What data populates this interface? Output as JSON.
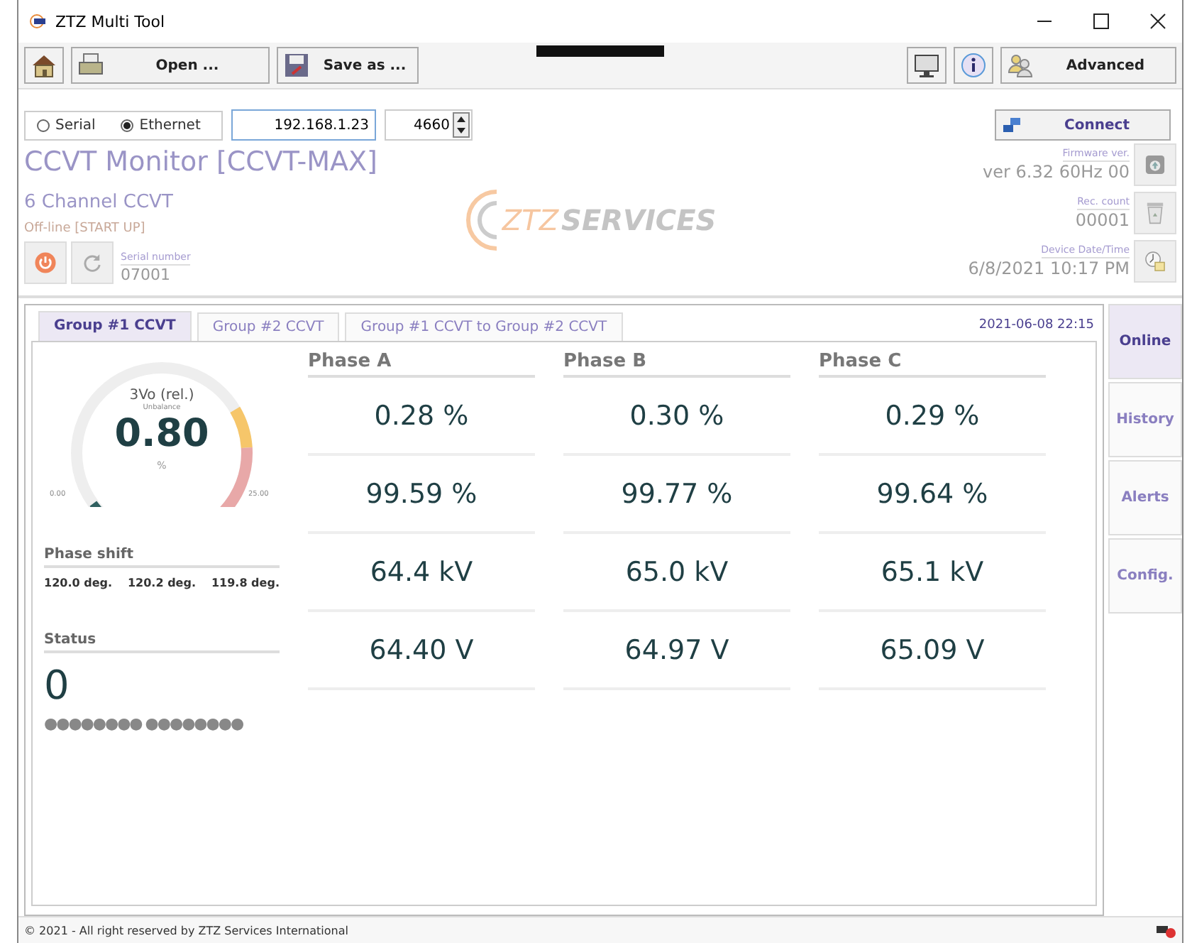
{
  "window": {
    "title": "ZTZ Multi Tool"
  },
  "toolbar": {
    "open": "Open ...",
    "save": "Save as ...",
    "advanced": "Advanced"
  },
  "connection": {
    "options": [
      {
        "label": "Serial",
        "selected": false
      },
      {
        "label": "Ethernet",
        "selected": true
      }
    ],
    "address": "192.168.1.23",
    "port": "4660",
    "connect": "Connect"
  },
  "device": {
    "title": "CCVT Monitor [CCVT-MAX]",
    "subtitle": "6 Channel CCVT",
    "state": "Off-line [START UP]",
    "serial_label": "Serial number",
    "serial": "07001"
  },
  "logo": {
    "brand": "ZTZ",
    "word": "SERVICES"
  },
  "info": [
    {
      "label": "Firmware ver.",
      "value": "ver 6.32  60Hz 00",
      "kind": "chip"
    },
    {
      "label": "Rec. count",
      "value": "00001",
      "kind": "bin"
    },
    {
      "label": "Device Date/Time",
      "value": "6/8/2021 10:17 PM",
      "kind": "clock"
    }
  ],
  "group_tabs": [
    {
      "label": "Group #1 CCVT",
      "selected": true
    },
    {
      "label": "Group #2 CCVT",
      "selected": false
    },
    {
      "label": "Group #1 CCVT to Group #2 CCVT",
      "selected": false
    }
  ],
  "timestamp": "2021-06-08 22:15",
  "gauge": {
    "title": "3Vo (rel.)",
    "subtitle": "Unbalance",
    "value": "0.80",
    "unit": "%",
    "min": "0.00",
    "max": "25.00"
  },
  "phase_shift": {
    "label": "Phase shift",
    "values": [
      "120.0 deg.",
      "120.2 deg.",
      "119.8 deg."
    ]
  },
  "status": {
    "label": "Status",
    "value": "0",
    "bits": "●●●●●●●● ●●●●●●●●"
  },
  "phases": [
    {
      "name": "Phase A",
      "values": [
        "0.28 %",
        "99.59 %",
        "64.4 kV",
        "64.40 V"
      ]
    },
    {
      "name": "Phase B",
      "values": [
        "0.30 %",
        "99.77 %",
        "65.0 kV",
        "64.97 V"
      ]
    },
    {
      "name": "Phase C",
      "values": [
        "0.29 %",
        "99.64 %",
        "65.1 kV",
        "65.09 V"
      ]
    }
  ],
  "side_tabs": [
    {
      "label": "Online",
      "selected": true
    },
    {
      "label": "History",
      "selected": false
    },
    {
      "label": "Alerts",
      "selected": false
    },
    {
      "label": "Config.",
      "selected": false
    }
  ],
  "status_bar": {
    "text": "© 2021 - All right reserved by ZTZ Services International"
  }
}
